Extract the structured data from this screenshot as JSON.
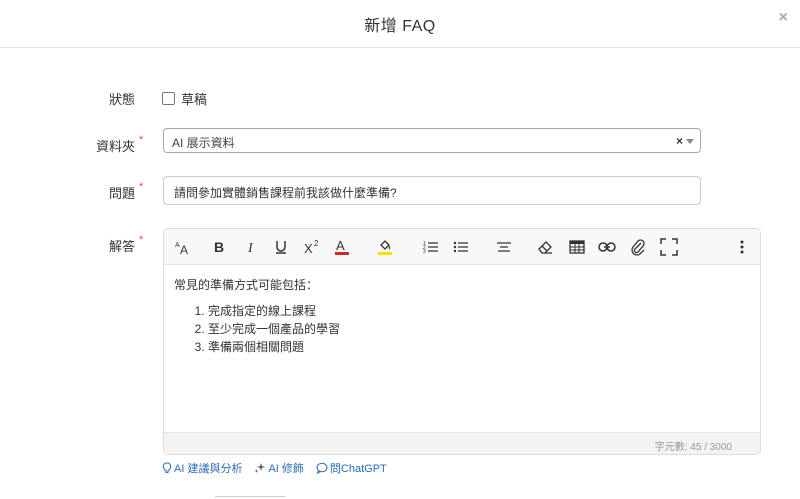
{
  "modal": {
    "title": "新增 FAQ",
    "close_label": "×"
  },
  "form": {
    "status": {
      "label": "狀態",
      "checkbox_label": "草稿",
      "checked": false
    },
    "folder": {
      "label": "資料夾",
      "required_mark": "*",
      "value": "AI 展示資料",
      "clear_label": "×"
    },
    "question": {
      "label": "問題",
      "required_mark": "*",
      "value": "請問參加實體銷售課程前我該做什麼準備?"
    },
    "answer": {
      "label": "解答",
      "required_mark": "*",
      "intro": "常見的準備方式可能包括：",
      "items": [
        "完成指定的線上課程",
        "至少完成一個產品的學習",
        "準備兩個相關問題"
      ],
      "char_count": "字元數: 45 / 3000"
    }
  },
  "toolbar": {
    "icons": [
      "font-size-icon",
      "bold-icon",
      "italic-icon",
      "underline-icon",
      "superscript-icon",
      "font-color-icon",
      "highlight-icon",
      "ordered-list-icon",
      "bullet-list-icon",
      "align-icon",
      "eraser-icon",
      "table-icon",
      "link-icon",
      "attachment-icon",
      "fullscreen-icon",
      "more-icon"
    ],
    "font_color": "#d62828",
    "highlight_color": "#f5e400"
  },
  "ai_links": {
    "analyze": "AI 建議與分析",
    "polish": "AI 修飾",
    "chatgpt": "問ChatGPT"
  },
  "colors": {
    "link": "#2a6ebb",
    "required": "#d9534f"
  }
}
